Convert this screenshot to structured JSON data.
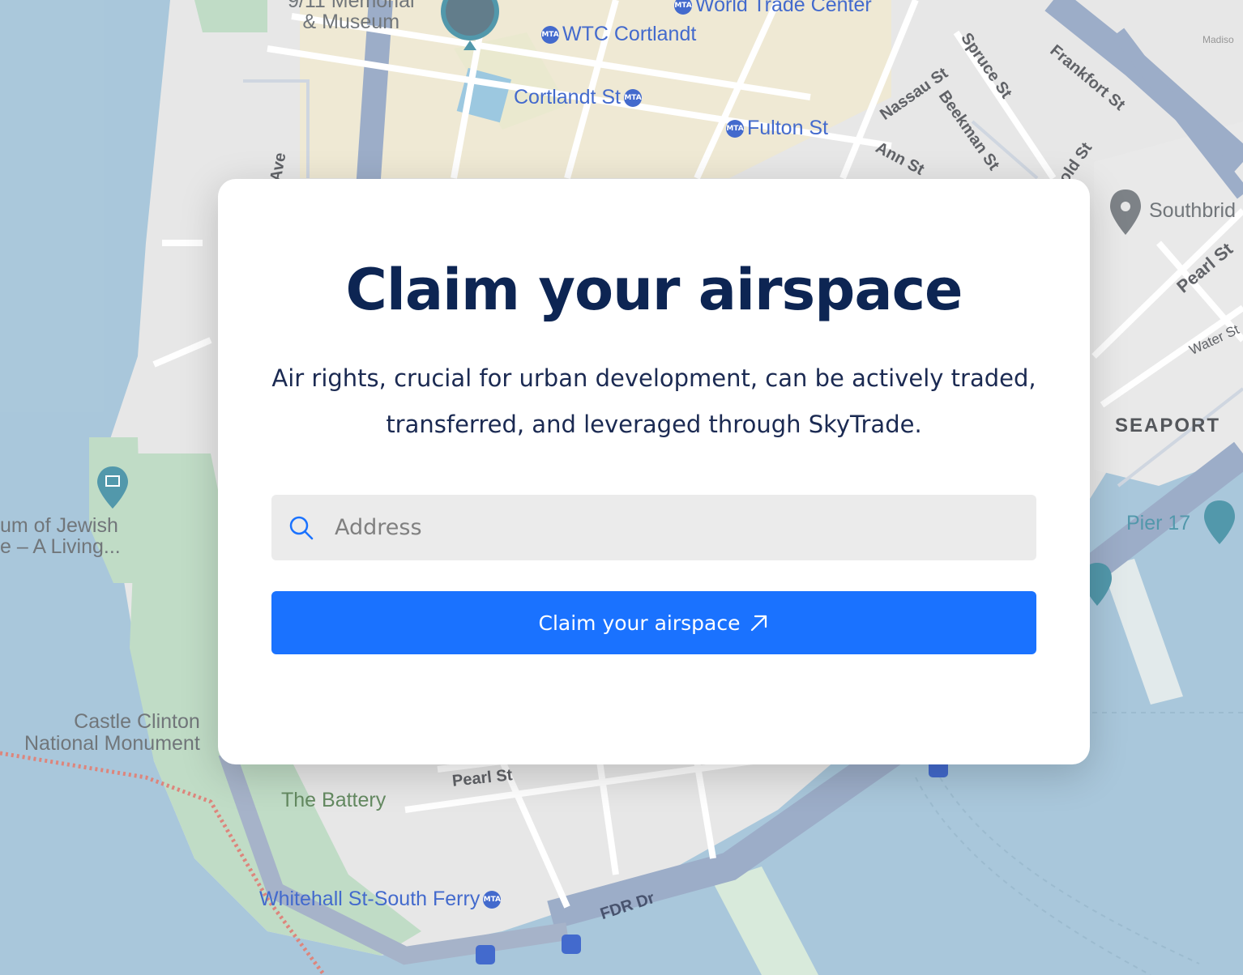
{
  "map": {
    "labels": {
      "memorial_line1": "9/11 Memorial",
      "memorial_line2": "& Museum",
      "world_trade_center": "World Trade Center",
      "wtc_cortlandt": "WTC Cortlandt",
      "cortlandt_st": "Cortlandt St",
      "fulton_st": "Fulton St",
      "nassau_st": "Nassau St",
      "spruce_st": "Spruce St",
      "beekman_st": "Beekman St",
      "frankfort_st": "Frankfort St",
      "ann_st": "Ann St",
      "gold_st": "old St",
      "ave": "Ave",
      "madison": "Madiso",
      "southbridge": "Southbrid",
      "pearl_st_east": "Pearl St",
      "water_st": "Water St",
      "seaport": "SEAPORT",
      "pier_17": "Pier 17",
      "jewish_museum_line1": "um of Jewish",
      "jewish_museum_line2": "e – A Living...",
      "castle_clinton_line1": "Castle Clinton",
      "castle_clinton_line2": "National Monument",
      "the_battery": "The Battery",
      "pearl_st_south": "Pearl St",
      "whitehall": "Whitehall St-South Ferry",
      "fdr_dr": "FDR Dr",
      "mta": "MTA"
    }
  },
  "modal": {
    "title": "Claim your airspace",
    "description": "Air rights, crucial for urban development, can be actively traded, transferred, and leveraged through SkyTrade.",
    "search": {
      "placeholder": "Address",
      "value": ""
    },
    "button_label": "Claim your airspace"
  },
  "colors": {
    "title": "#0d2553",
    "button": "#1a72ff",
    "search_bg": "#ebebeb",
    "water": "#9ec0d6",
    "land": "#e4e4e4",
    "park": "#b8d8bf"
  },
  "icons": {
    "search": "search-icon",
    "button_arrow": "arrow-up-right-icon",
    "transit": "mta-icon",
    "place_pin": "map-pin-icon"
  }
}
